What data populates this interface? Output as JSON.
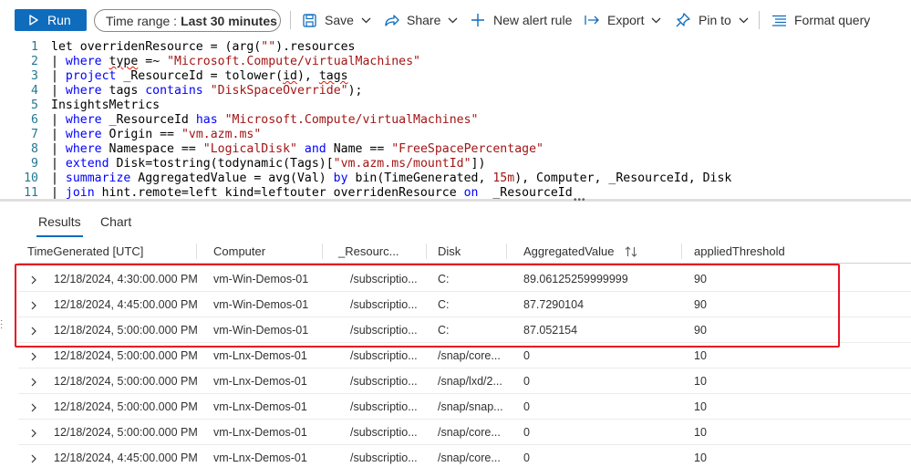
{
  "toolbar": {
    "run_label": "Run",
    "time_range_prefix": "Time range :",
    "time_range_value": "Last 30 minutes",
    "save_label": "Save",
    "share_label": "Share",
    "new_alert_label": "New alert rule",
    "export_label": "Export",
    "pin_label": "Pin to",
    "format_label": "Format query"
  },
  "editor": {
    "line_numbers": [
      "1",
      "2",
      "3",
      "4",
      "5",
      "6",
      "7",
      "8",
      "9",
      "10",
      "11"
    ]
  },
  "tabs": {
    "results": "Results",
    "chart": "Chart"
  },
  "table": {
    "columns": [
      "TimeGenerated [UTC]",
      "Computer",
      "_Resourc...",
      "Disk",
      "AggregatedValue",
      "appliedThreshold"
    ],
    "rows": [
      [
        "12/18/2024, 4:30:00.000 PM",
        "vm-Win-Demos-01",
        "/subscriptio...",
        "C:",
        "89.06125259999999",
        "90"
      ],
      [
        "12/18/2024, 4:45:00.000 PM",
        "vm-Win-Demos-01",
        "/subscriptio...",
        "C:",
        "87.7290104",
        "90"
      ],
      [
        "12/18/2024, 5:00:00.000 PM",
        "vm-Win-Demos-01",
        "/subscriptio...",
        "C:",
        "87.052154",
        "90"
      ],
      [
        "12/18/2024, 5:00:00.000 PM",
        "vm-Lnx-Demos-01",
        "/subscriptio...",
        "/snap/core...",
        "0",
        "10"
      ],
      [
        "12/18/2024, 5:00:00.000 PM",
        "vm-Lnx-Demos-01",
        "/subscriptio...",
        "/snap/lxd/2...",
        "0",
        "10"
      ],
      [
        "12/18/2024, 5:00:00.000 PM",
        "vm-Lnx-Demos-01",
        "/subscriptio...",
        "/snap/snap...",
        "0",
        "10"
      ],
      [
        "12/18/2024, 5:00:00.000 PM",
        "vm-Lnx-Demos-01",
        "/subscriptio...",
        "/snap/core...",
        "0",
        "10"
      ],
      [
        "12/18/2024, 4:45:00.000 PM",
        "vm-Lnx-Demos-01",
        "/subscriptio...",
        "/snap/core...",
        "0",
        "10"
      ]
    ]
  },
  "colors": {
    "accent": "#0f6cbd",
    "highlight_border": "#e81123",
    "keyword": "#0000ff",
    "string": "#a31515"
  }
}
